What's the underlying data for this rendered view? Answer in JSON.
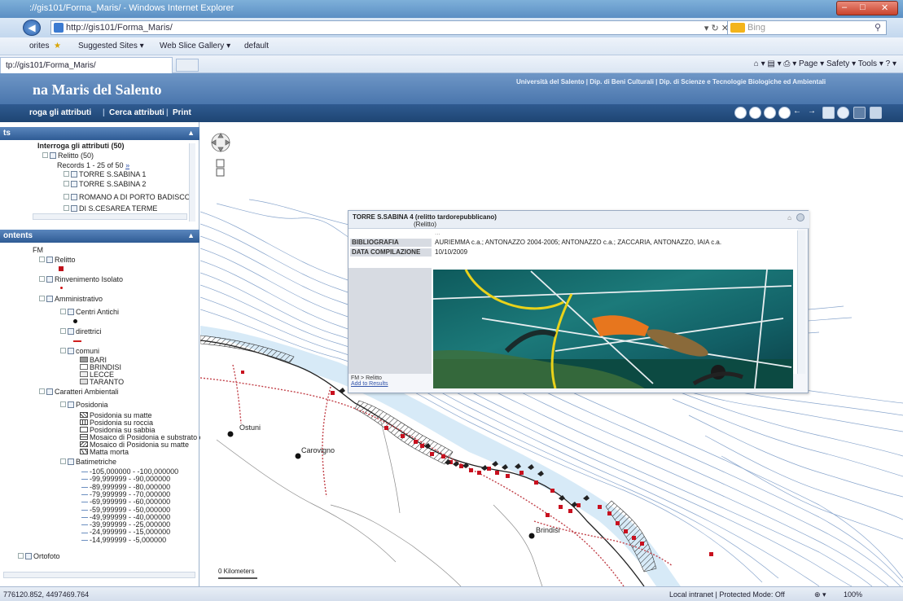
{
  "browser": {
    "title": "://gis101/Forma_Maris/ - Windows Internet Explorer",
    "url": "http://gis101/Forma_Maris/",
    "search_placeholder": "Bing",
    "favorites_label": "orites",
    "favorites_items": [
      "Suggested Sites ▾",
      "Web Slice Gallery ▾",
      "default"
    ],
    "tab_title": "tp://gis101/Forma_Maris/",
    "command_items": [
      "Page ▾",
      "Safety ▾",
      "Tools ▾"
    ]
  },
  "app": {
    "title": "na Maris del Salento",
    "header_links": "Università del Salento  |  Dip. di Beni Culturali  |  Dip. di Scienze e Tecnologie Biologiche ed Ambientali",
    "menu": [
      "roga gli attributi",
      "Cerca attributi",
      "Print"
    ]
  },
  "query_panel": {
    "header": "ts",
    "title": "Interroga gli attributi (50)",
    "layer": "Relitto (50)",
    "records_label": "Records 1 - 25 of 50",
    "records_link": "»",
    "items": [
      "TORRE S.SABINA 1",
      "TORRE S.SABINA 2",
      "ROMANO A DI PORTO BADISCO",
      "DI S.CESAREA TERME"
    ]
  },
  "contents_panel": {
    "header": "ontents",
    "root": "FM",
    "layers": [
      {
        "label": "Relitto",
        "indent": 1
      },
      {
        "label": "Rinvenimento Isolato",
        "indent": 1
      },
      {
        "label": "Amministrativo",
        "indent": 1
      },
      {
        "label": "Centri Antichi",
        "indent": 2
      },
      {
        "label": "direttrici",
        "indent": 2
      },
      {
        "label": "comuni",
        "indent": 2
      },
      {
        "label": "Caratteri Ambientali",
        "indent": 1
      },
      {
        "label": "Posidonia",
        "indent": 2
      },
      {
        "label": "Batimetriche",
        "indent": 2
      }
    ],
    "comuni_legend": [
      "BARI",
      "BRINDISI",
      "LECCE",
      "TARANTO"
    ],
    "posidonia_legend": [
      "Posidonia su matte",
      "Posidonia su roccia",
      "Posidonia su sabbia",
      "Mosaico di Posidonia e substrato c",
      "Mosaico di Posidonia su matte",
      "Matta morta"
    ],
    "bathymetry_legend": [
      "-105,000000 - -100,000000",
      "-99,999999 - -90,000000",
      "-89,999999 - -80,000000",
      "-79,999999 - -70,000000",
      "-69,999999 - -60,000000",
      "-59,999999 - -50,000000",
      "-49,999999 - -40,000000",
      "-39,999999 - -25,000000",
      "-24,999999 - -15,000000",
      "-14,999999 - -5,000000"
    ],
    "ortofoto": "Ortofoto"
  },
  "map": {
    "towns": [
      "Ostuni",
      "Carovigno",
      "Brindisi"
    ],
    "scale_label": "0 Kilometers"
  },
  "popup": {
    "title": "TORRE S.SABINA 4 (relitto tardorepubblicano)",
    "layer": "(Relitto)",
    "cut_text": "...",
    "rows": [
      {
        "key": "BIBLIOGRAFIA",
        "value": "AURIEMMA c.a.; ANTONAZZO 2004-2005; ANTONAZZO c.a.; ZACCARIA, ANTONAZZO, IAIA c.a."
      },
      {
        "key": "DATA COMPILAZIONE",
        "value": "10/10/2009"
      }
    ],
    "footer_layer": "FM > Relitto",
    "footer_link": "Add to Results"
  },
  "status": {
    "coords": "776120.852, 4497469.764",
    "zone": "Local intranet | Protected Mode: Off",
    "zoom": "100%"
  }
}
